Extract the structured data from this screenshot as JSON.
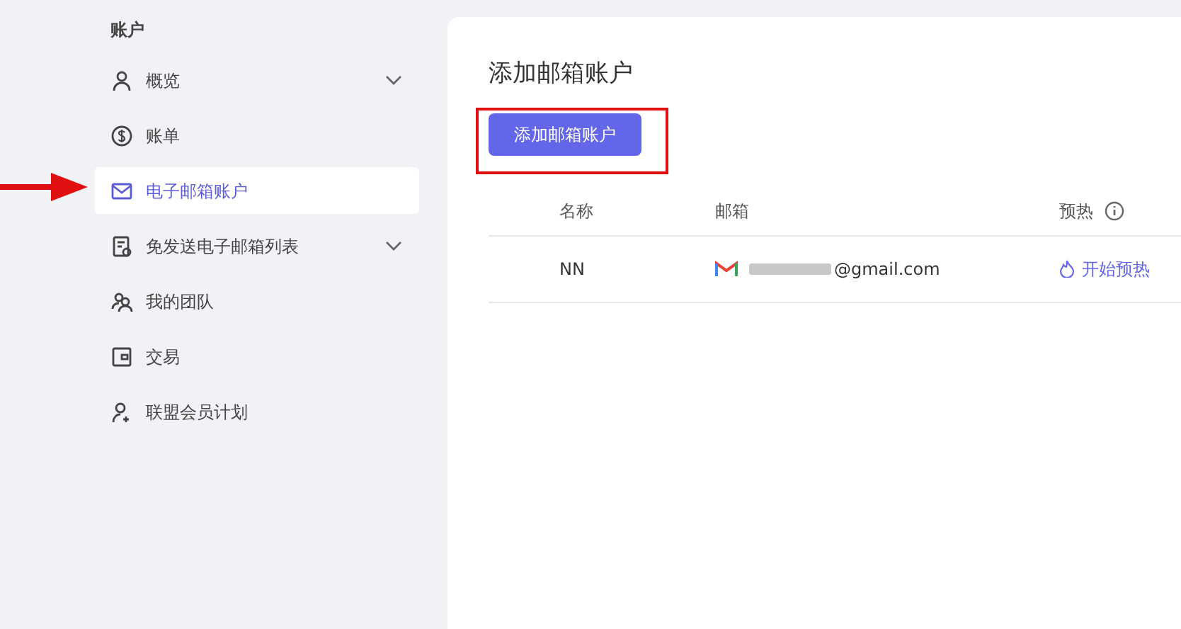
{
  "sidebar": {
    "heading": "账户",
    "items": [
      {
        "label": "概览",
        "selected": false,
        "has_submenu": true
      },
      {
        "label": "账单",
        "selected": false,
        "has_submenu": false
      },
      {
        "label": "电子邮箱账户",
        "selected": true,
        "has_submenu": false
      },
      {
        "label": "免发送电子邮箱列表",
        "selected": false,
        "has_submenu": true
      },
      {
        "label": "我的团队",
        "selected": false,
        "has_submenu": false
      },
      {
        "label": "交易",
        "selected": false,
        "has_submenu": false
      },
      {
        "label": "联盟会员计划",
        "selected": false,
        "has_submenu": false
      }
    ]
  },
  "main": {
    "title": "添加邮箱账户",
    "add_button": "添加邮箱账户",
    "table": {
      "columns": [
        "名称",
        "邮箱",
        "预热"
      ],
      "rows": [
        {
          "name": "NN",
          "email": "@gmail.com",
          "action": "开始预热"
        }
      ]
    }
  }
}
